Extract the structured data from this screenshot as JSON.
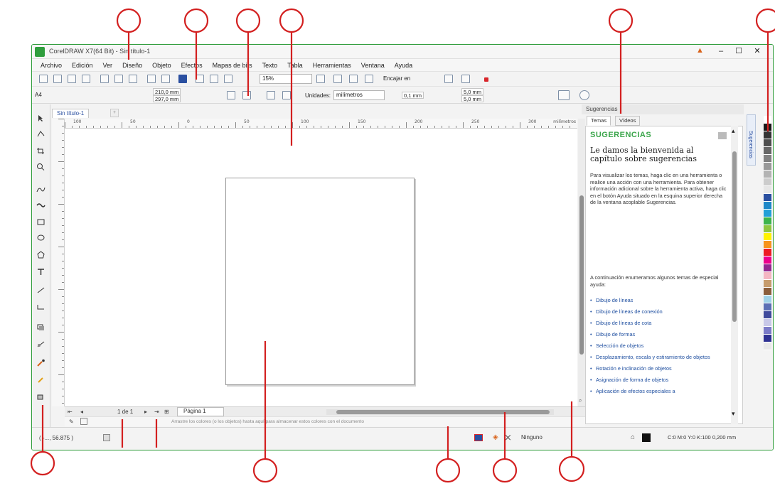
{
  "window": {
    "title": "CorelDRAW X7(64 Bit) - Sin título-1",
    "min": "–",
    "max": "☐",
    "close": "✕"
  },
  "menu": [
    "Archivo",
    "Edición",
    "Ver",
    "Diseño",
    "Objeto",
    "Efectos",
    "Mapas de bits",
    "Texto",
    "Tabla",
    "Herramientas",
    "Ventana",
    "Ayuda"
  ],
  "toolbar": {
    "zoom": "15%",
    "snap": "Encajar en"
  },
  "property_bar": {
    "paper": "A4",
    "width": "210,0 mm",
    "height": "297,0 mm",
    "units_label": "Unidades:",
    "units_value": "milímetros",
    "nudge": "0,1 mm",
    "dup_x": "5,0 mm",
    "dup_y": "5,0 mm"
  },
  "document": {
    "tab": "Sin título-1",
    "ruler_unit": "milímetros",
    "hruler_labels": [
      "100",
      "50",
      "0",
      "50",
      "100",
      "150",
      "200",
      "250",
      "300"
    ]
  },
  "page_nav": {
    "count": "1 de 1",
    "page_tab": "Página 1"
  },
  "palette_hint": "Arrastre los colores (o los objetos) hasta aquí para almacenar estos colores con el documento",
  "status": {
    "coords": "( -..., 56.875 )",
    "fill": "Ninguno",
    "outline": "C:0 M:0 Y:0 K:100  0,200 mm"
  },
  "docker": {
    "title": "Sugerencias",
    "tabs": [
      "Temas",
      "Vídeos"
    ],
    "heading": "SUGERENCIAS",
    "welcome": "Le damos la bienvenida al capítulo sobre sugerencias",
    "intro": "Para visualizar los temas, haga clic en una herramienta o realice una acción con una herramienta. Para obtener información adicional sobre la herramienta activa, haga clic en el botón Ayuda situado en la esquina superior derecha de la ventana acoplable Sugerencias.",
    "list_intro": "A continuación enumeramos algunos temas de especial ayuda:",
    "topics": [
      "Dibujo de líneas",
      "Dibujo de líneas de conexión",
      "Dibujo de líneas de cota",
      "Dibujo de formas",
      "Selección de objetos",
      "Desplazamiento, escala y estiramiento de objetos",
      "Rotación e inclinación de objetos",
      "Asignación de forma de objetos",
      "Aplicación de efectos especiales a"
    ],
    "side_tab": "Sugerencias"
  },
  "colors": {
    "accent": "#2e9c3a",
    "annotation": "#d32020",
    "link": "#1f4fa0",
    "palette": [
      "#ffffff",
      "#1a1a1a",
      "#333333",
      "#4d4d4d",
      "#666666",
      "#808080",
      "#999999",
      "#b3b3b3",
      "#cccccc",
      "#e6e6e6",
      "#2a4fa0",
      "#1e88c8",
      "#22a0d8",
      "#3cb44a",
      "#8ec63f",
      "#fff200",
      "#f7941d",
      "#ed1c24",
      "#ec008c",
      "#92278f",
      "#f4b6c2",
      "#c69c6d",
      "#8b5e3c",
      "#a0d2e8",
      "#5b6fb5",
      "#3f4a9c",
      "#c8c8e8",
      "#7b7bc8",
      "#2e3192",
      "#e8e8e8"
    ]
  }
}
